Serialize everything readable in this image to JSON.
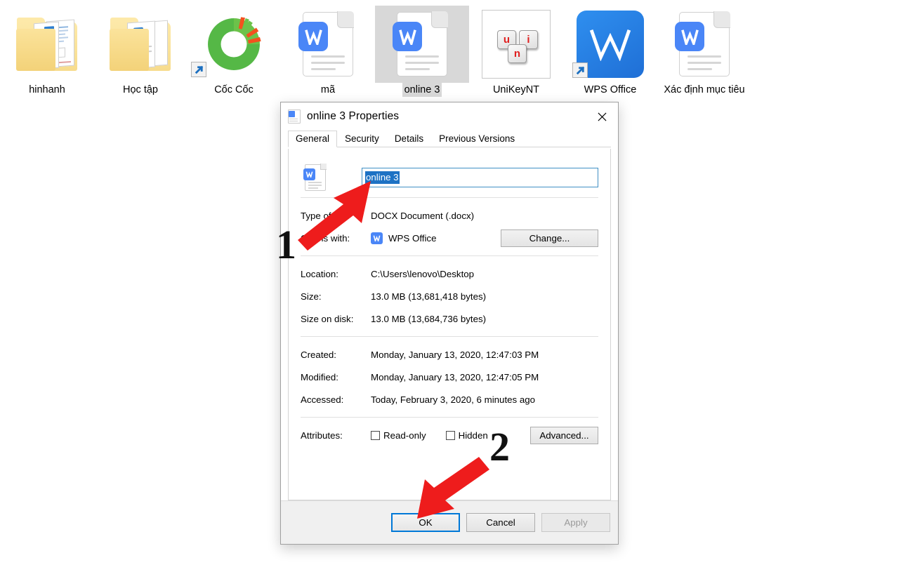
{
  "desktop": {
    "icons": [
      {
        "label": "hinhanh",
        "type": "folder-photos",
        "selected": false,
        "shortcut": false
      },
      {
        "label": "Học tập",
        "type": "folder-docs",
        "selected": false,
        "shortcut": false
      },
      {
        "label": "Cốc Cốc",
        "type": "coccoc-logo",
        "selected": false,
        "shortcut": true
      },
      {
        "label": "mã",
        "type": "docx-file",
        "selected": false,
        "shortcut": false
      },
      {
        "label": "online 3",
        "type": "docx-file",
        "selected": true,
        "shortcut": false
      },
      {
        "label": "UniKeyNT",
        "type": "unikey-keys",
        "selected": false,
        "shortcut": false
      },
      {
        "label": "WPS Office",
        "type": "wps-office-tile",
        "selected": false,
        "shortcut": true
      },
      {
        "label": "Xác định mục tiêu",
        "type": "docx-file",
        "selected": false,
        "shortcut": false
      }
    ]
  },
  "dialog": {
    "title": "online 3 Properties",
    "title_icon": "docx-file-icon",
    "close_label": "✕",
    "tabs": [
      {
        "label": "General",
        "active": true
      },
      {
        "label": "Security",
        "active": false
      },
      {
        "label": "Details",
        "active": false
      },
      {
        "label": "Previous Versions",
        "active": false
      }
    ],
    "general": {
      "file_icon": "docx-file-icon",
      "name_value": "online 3",
      "name_placeholder": "",
      "type_of_file_label": "Type of file:",
      "type_of_file_value": "DOCX Document (.docx)",
      "opens_with_label": "Opens with:",
      "opens_with_value": "WPS Office",
      "opens_with_icon": "wps-w-icon",
      "change_button": "Change...",
      "location_label": "Location:",
      "location_value": "C:\\Users\\lenovo\\Desktop",
      "size_label": "Size:",
      "size_value": "13.0 MB (13,681,418 bytes)",
      "size_on_disk_label": "Size on disk:",
      "size_on_disk_value": "13.0 MB (13,684,736 bytes)",
      "created_label": "Created:",
      "created_value": "Monday, January 13, 2020, 12:47:03 PM",
      "modified_label": "Modified:",
      "modified_value": "Monday, January 13, 2020, 12:47:05 PM",
      "accessed_label": "Accessed:",
      "accessed_value": "Today, February 3, 2020, 6 minutes ago",
      "attributes_label": "Attributes:",
      "readonly_label": "Read-only",
      "readonly_checked": false,
      "hidden_label": "Hidden",
      "hidden_checked": false,
      "advanced_button": "Advanced..."
    },
    "buttons": {
      "ok": "OK",
      "cancel": "Cancel",
      "apply": "Apply",
      "apply_disabled": true
    }
  },
  "annotations": {
    "step1_number": "1",
    "step2_number": "2",
    "arrow_color": "#ee1c1c"
  },
  "colors": {
    "accent_blue": "#0078d7",
    "selection_blue": "#1d72c4",
    "dialog_bg": "#ffffff",
    "button_bar_bg": "#f0f0f0",
    "word_blue": "#4a86f7",
    "annotation_red": "#ee1c1c"
  }
}
